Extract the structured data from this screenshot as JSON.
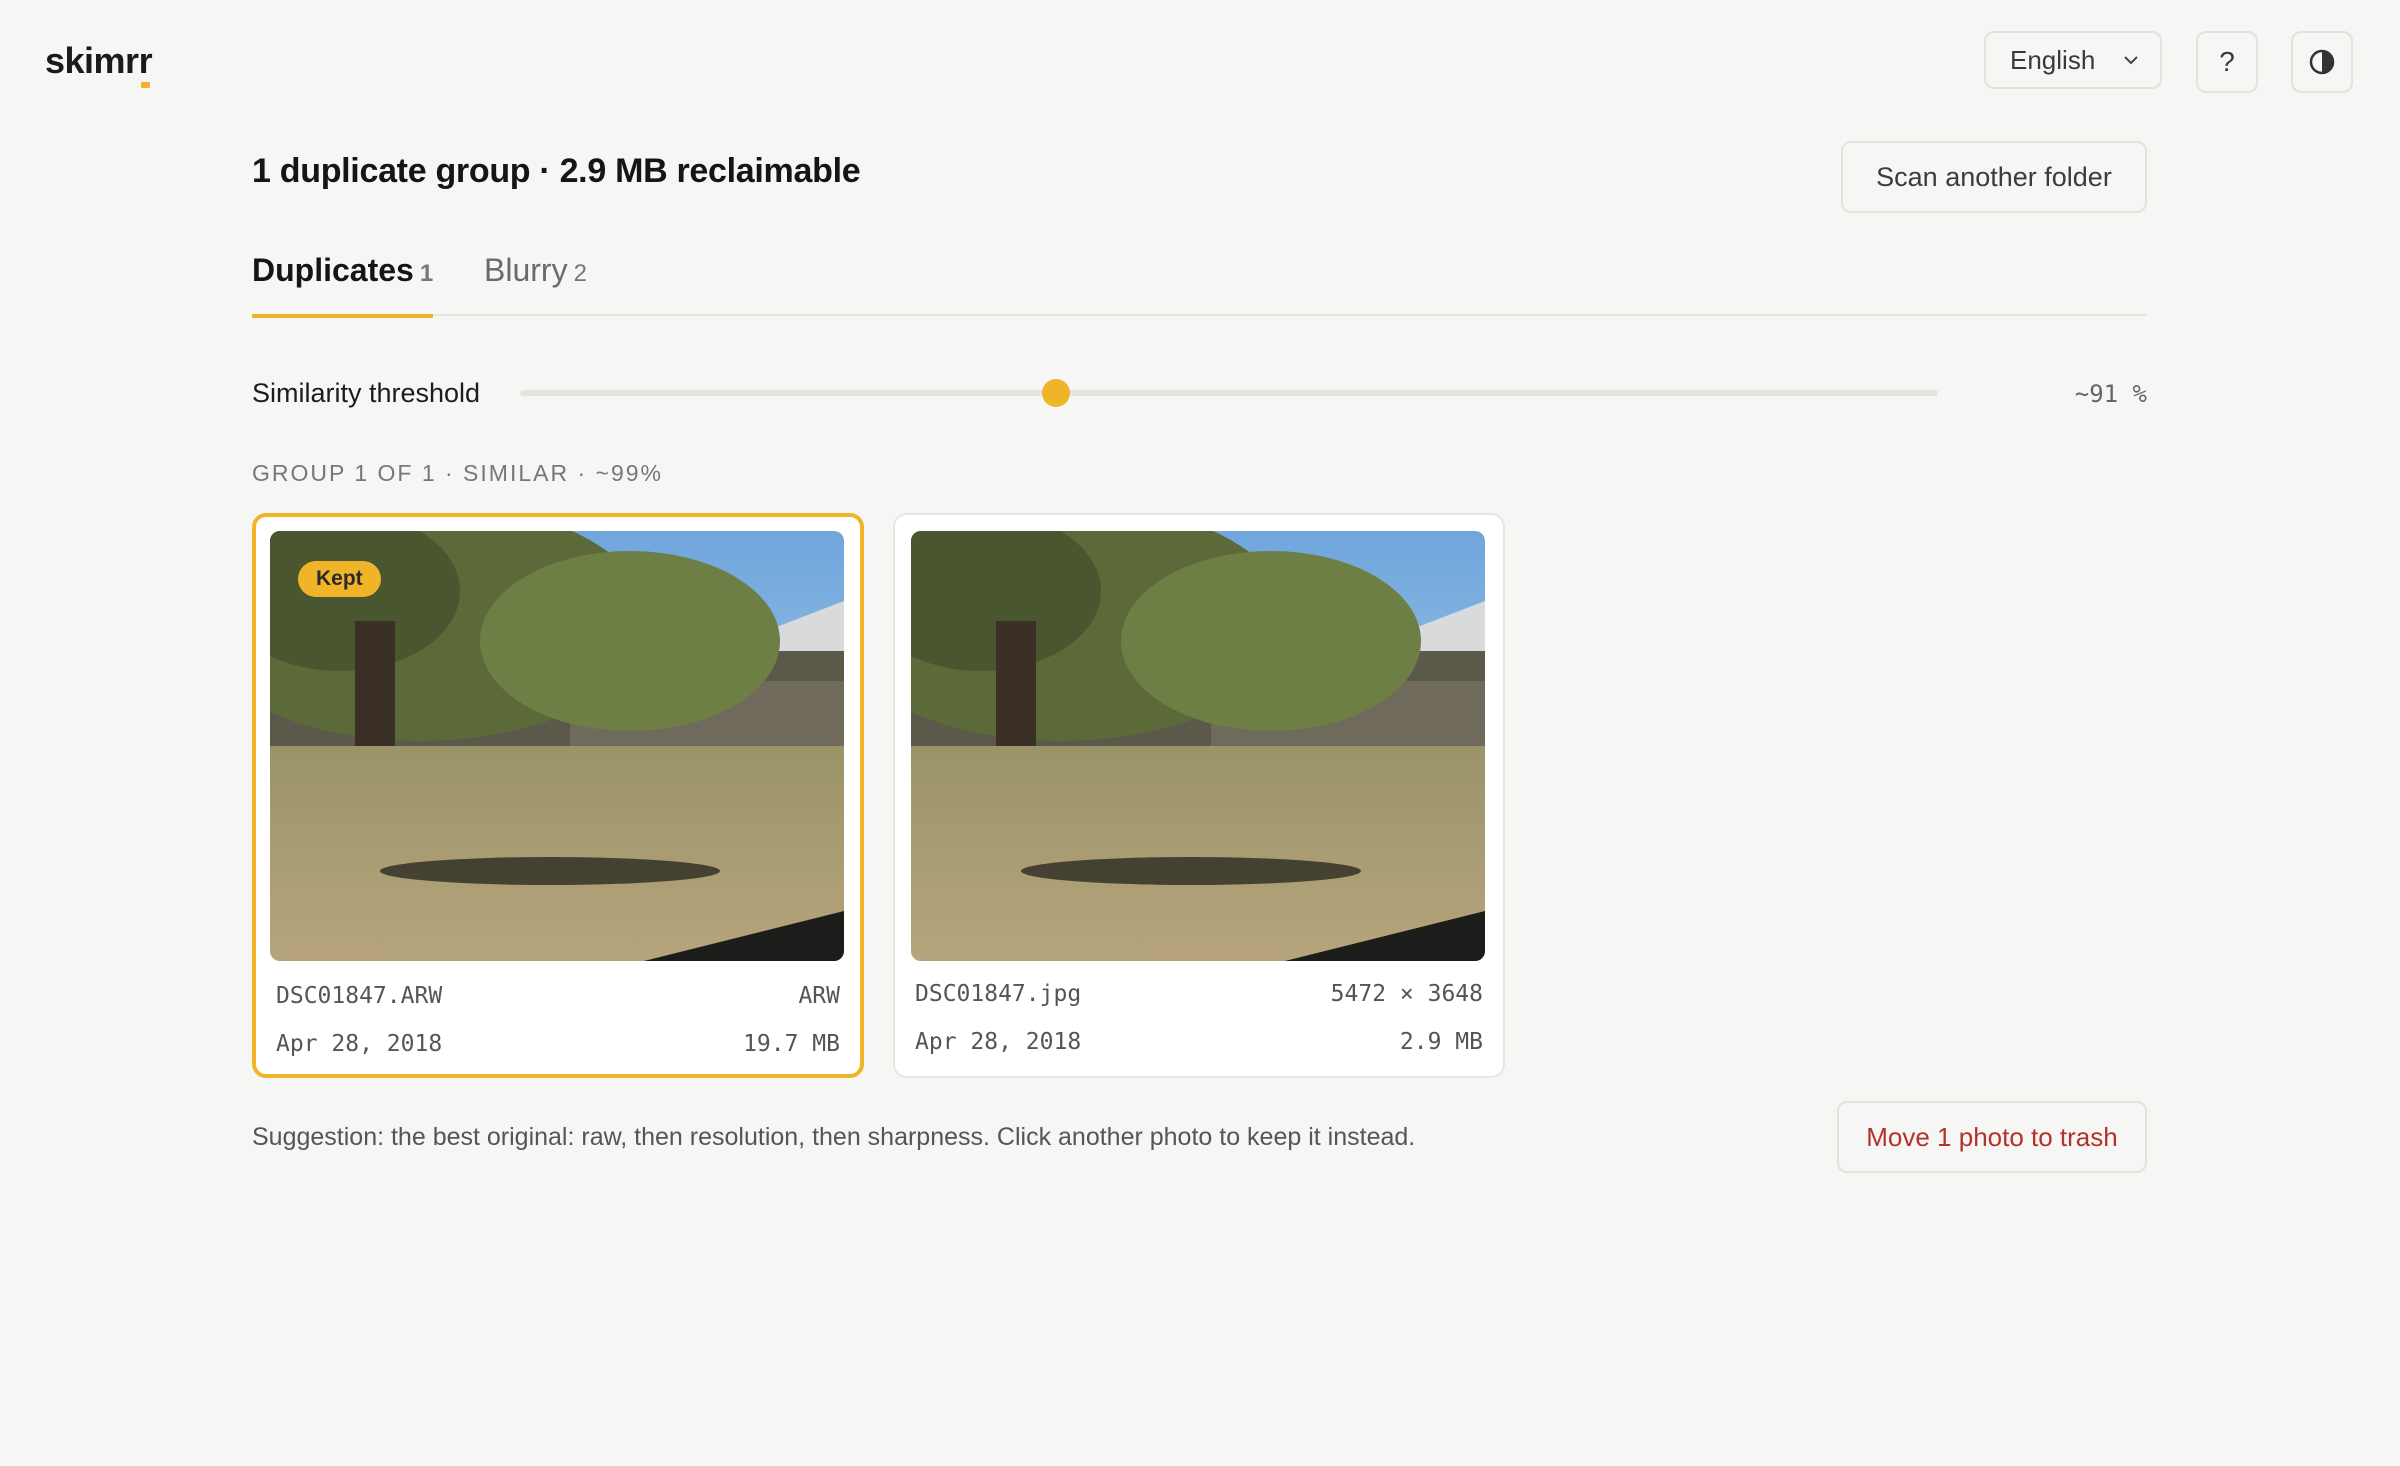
{
  "app": {
    "logo_main": "skimr",
    "logo_accent": "r",
    "language": "English",
    "help_label": "?"
  },
  "header": {
    "title": "1 duplicate group · 2.9 MB reclaimable",
    "scan_button": "Scan another folder"
  },
  "tabs": [
    {
      "label": "Duplicates",
      "count": "1",
      "active": true
    },
    {
      "label": "Blurry",
      "count": "2",
      "active": false
    }
  ],
  "threshold": {
    "label": "Similarity threshold",
    "value_text": "~91 %",
    "position_fraction": 0.378
  },
  "group": {
    "label": "GROUP 1 OF 1 · SIMILAR · ~99%",
    "photos": [
      {
        "kept": true,
        "badge": "Kept",
        "filename": "DSC01847.ARW",
        "format": "ARW",
        "date": "Apr 28, 2018",
        "size": "19.7 MB"
      },
      {
        "kept": false,
        "filename": "DSC01847.jpg",
        "resolution": "5472 × 3648",
        "date": "Apr 28, 2018",
        "size": "2.9 MB"
      }
    ]
  },
  "footer": {
    "suggestion": "Suggestion: the best original: raw, then resolution, then sharpness. Click another photo to keep it instead.",
    "trash_button": "Move 1 photo to trash"
  },
  "colors": {
    "accent": "#f0b429",
    "danger": "#b3322b",
    "background": "#f6f6f4"
  },
  "icons": {
    "language_dropdown": "chevron-down-icon",
    "help": "help-icon",
    "theme": "contrast-icon"
  }
}
